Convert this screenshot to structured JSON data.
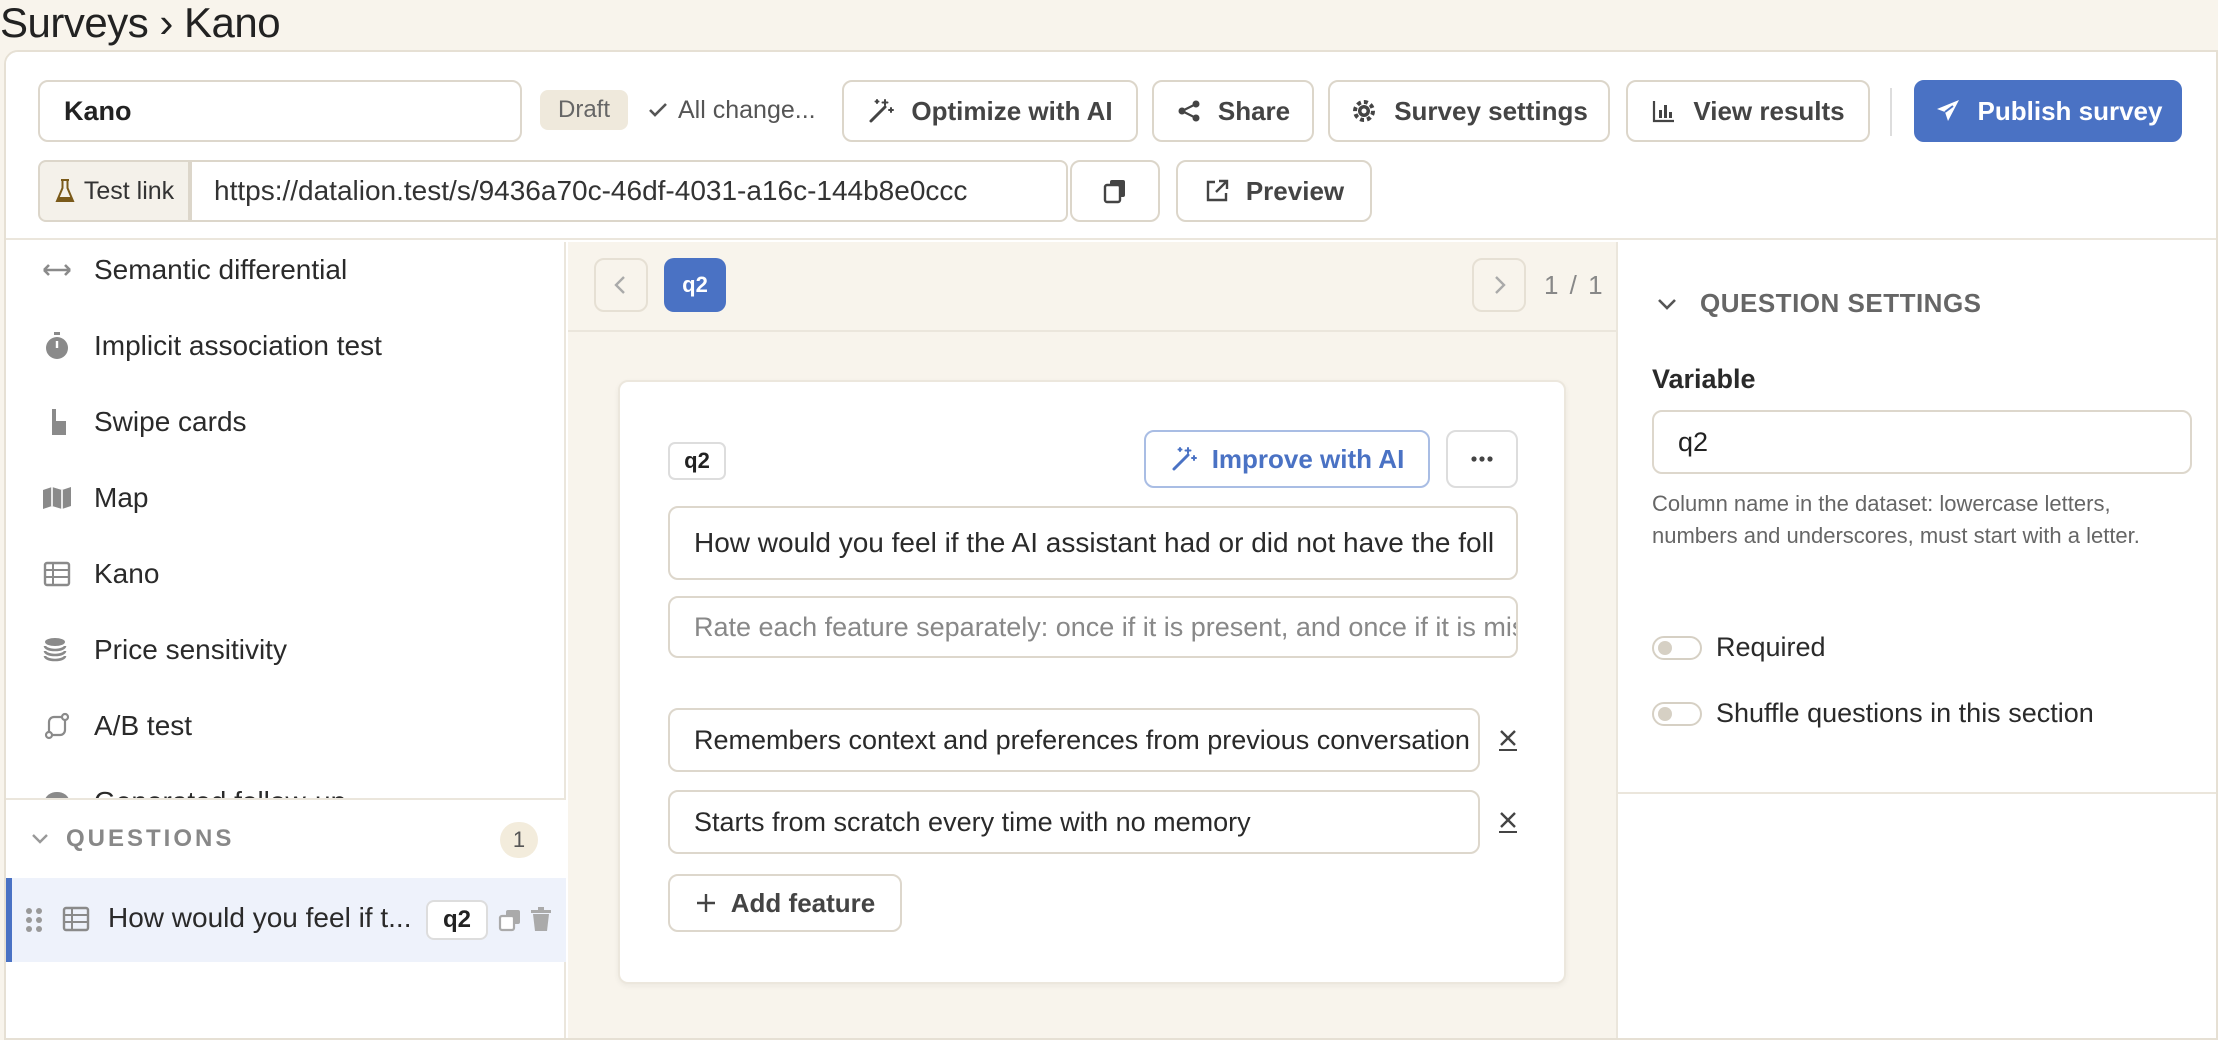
{
  "breadcrumb": "Surveys › Kano",
  "toolbar": {
    "survey_name": "Kano",
    "status_badge": "Draft",
    "save_status": "All change...",
    "optimize_label": "Optimize with AI",
    "share_label": "Share",
    "settings_label": "Survey settings",
    "results_label": "View results",
    "publish_label": "Publish survey",
    "test_link_label": "Test link",
    "test_url": "https://datalion.test/s/9436a70c-46df-4031-a16c-144b8e0ccc",
    "preview_label": "Preview"
  },
  "sidebar": {
    "question_types": [
      {
        "label": "Semantic differential",
        "icon": "arrows-horizontal-icon"
      },
      {
        "label": "Implicit association test",
        "icon": "stopwatch-icon"
      },
      {
        "label": "Swipe cards",
        "icon": "pointer-hand-icon"
      },
      {
        "label": "Map",
        "icon": "map-icon"
      },
      {
        "label": "Kano",
        "icon": "table-icon"
      },
      {
        "label": "Price sensitivity",
        "icon": "coins-icon"
      },
      {
        "label": "A/B test",
        "icon": "split-icon"
      },
      {
        "label": "Generated follow-up",
        "icon": "chat-icon"
      }
    ],
    "questions_header": "QUESTIONS",
    "questions_count": "1",
    "question_row": {
      "text": "How would you feel if t...",
      "variable": "q2"
    }
  },
  "editor": {
    "current_tab": "q2",
    "pager": "1 / 1",
    "card": {
      "variable_chip": "q2",
      "improve_label": "Improve with AI",
      "title": "How would you feel if the AI assistant had or did not have the foll",
      "description": "Rate each feature separately: once if it is present, and once if it is mis",
      "options": [
        "Remembers context and preferences from previous conversation",
        "Starts from scratch every time with no memory"
      ],
      "add_feature_label": "Add feature"
    }
  },
  "settings_panel": {
    "header": "QUESTION SETTINGS",
    "variable_label": "Variable",
    "variable_value": "q2",
    "variable_help": "Column name in the dataset: lowercase letters, numbers and underscores, must start with a letter.",
    "required_label": "Required",
    "shuffle_label": "Shuffle questions in this section"
  },
  "colors": {
    "accent": "#4a72c4",
    "background": "#f8f4ec"
  }
}
